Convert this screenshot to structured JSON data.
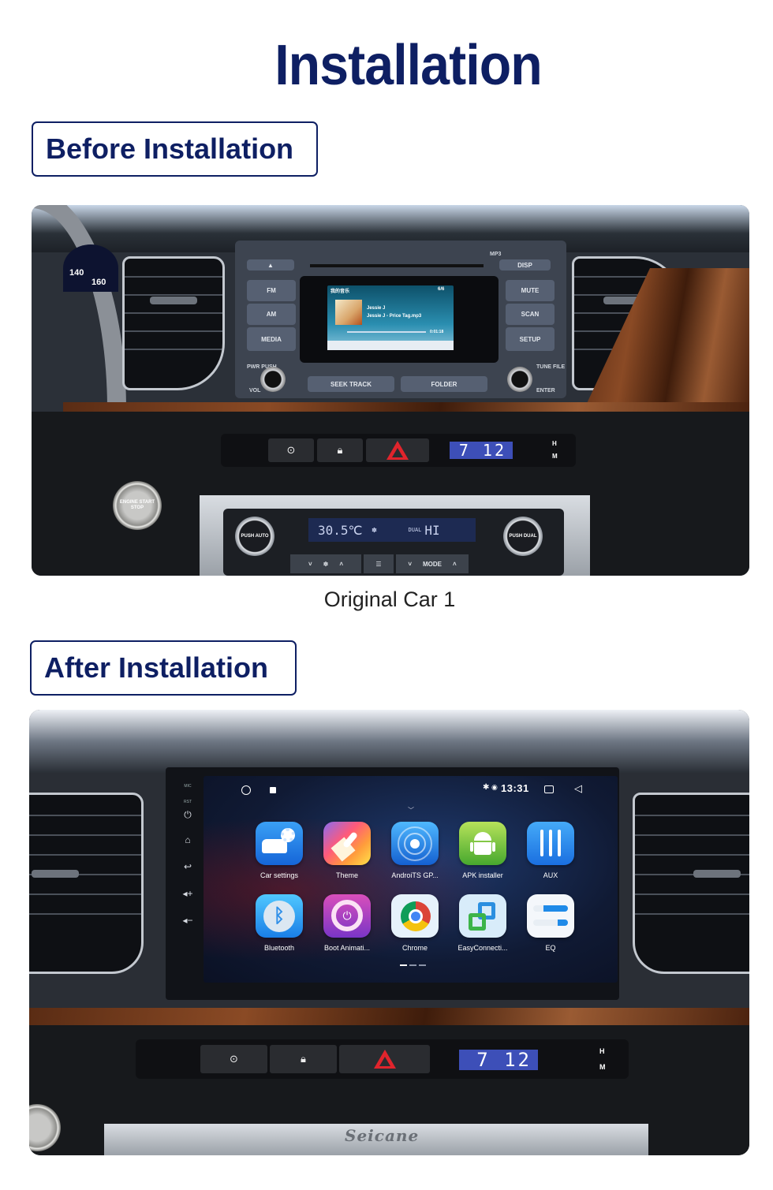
{
  "page": {
    "title": "Installation"
  },
  "before": {
    "label": "Before Installation",
    "caption": "Original Car  1",
    "radio": {
      "top_buttons": [
        "▲",
        "DISP"
      ],
      "left_buttons": [
        "FM",
        "AM",
        "MEDIA"
      ],
      "right_buttons": [
        "MUTE",
        "SCAN",
        "SETUP"
      ],
      "bottom_left": [
        "PWR PUSH",
        "VOL"
      ],
      "bottom_right": [
        "TUNE FILE",
        "ENTER"
      ],
      "seek_label": "SEEK TRACK",
      "folder_label": "FOLDER",
      "mp3_label": "MP3",
      "screen": {
        "title": "我的音乐",
        "track_count": "6/6",
        "artist": "Jessie J",
        "track": "Jessie J - Price Tag.mp3",
        "elapsed": "0:01:18"
      }
    },
    "switch_panel": {
      "clock": "7 12",
      "clock_buttons": [
        "H",
        "M"
      ]
    },
    "start_button": "ENGINE START STOP",
    "climate": {
      "left_dial": "PUSH AUTO",
      "right_dial": "PUSH DUAL",
      "temp": "30.5℃",
      "fan": "HI",
      "dual_label": "DUAL",
      "mode_label": "MODE"
    },
    "speedo": [
      "140",
      "160"
    ]
  },
  "after": {
    "label": "After Installation",
    "head_unit": {
      "side_buttons": [
        "MIC",
        "RST",
        "power",
        "home",
        "back",
        "vol+",
        "vol-"
      ],
      "status": {
        "time": "13:31",
        "bluetooth_icon": "bluetooth-icon",
        "location_icon": "location-icon"
      },
      "apps": [
        {
          "name": "Car settings",
          "icon": "car-settings-icon",
          "color": "#1e88e5"
        },
        {
          "name": "Theme",
          "icon": "theme-brush-icon",
          "color": "#ff5a7a"
        },
        {
          "name": "AndroiTS GP...",
          "icon": "gps-radar-icon",
          "color": "#1976d2"
        },
        {
          "name": "APK installer",
          "icon": "android-icon",
          "color": "#7cc43a"
        },
        {
          "name": "AUX",
          "icon": "aux-jack-icon",
          "color": "#1e7ce6"
        },
        {
          "name": "Bluetooth",
          "icon": "bluetooth-app-icon",
          "color": "#29a3f0"
        },
        {
          "name": "Boot Animati...",
          "icon": "power-icon",
          "color": "#9c3fc4"
        },
        {
          "name": "Chrome",
          "icon": "chrome-icon",
          "color": "#e6f2fb"
        },
        {
          "name": "EasyConnecti...",
          "icon": "easyconnection-icon",
          "color": "#d8ecfa"
        },
        {
          "name": "EQ",
          "icon": "eq-sliders-icon",
          "color": "#f4f7fb"
        }
      ],
      "page_indicator": {
        "pages": 3,
        "current": 1
      }
    },
    "switch_panel": {
      "clock": "7 12",
      "clock_buttons": [
        "H",
        "M"
      ]
    },
    "watermark": "Seicane"
  }
}
